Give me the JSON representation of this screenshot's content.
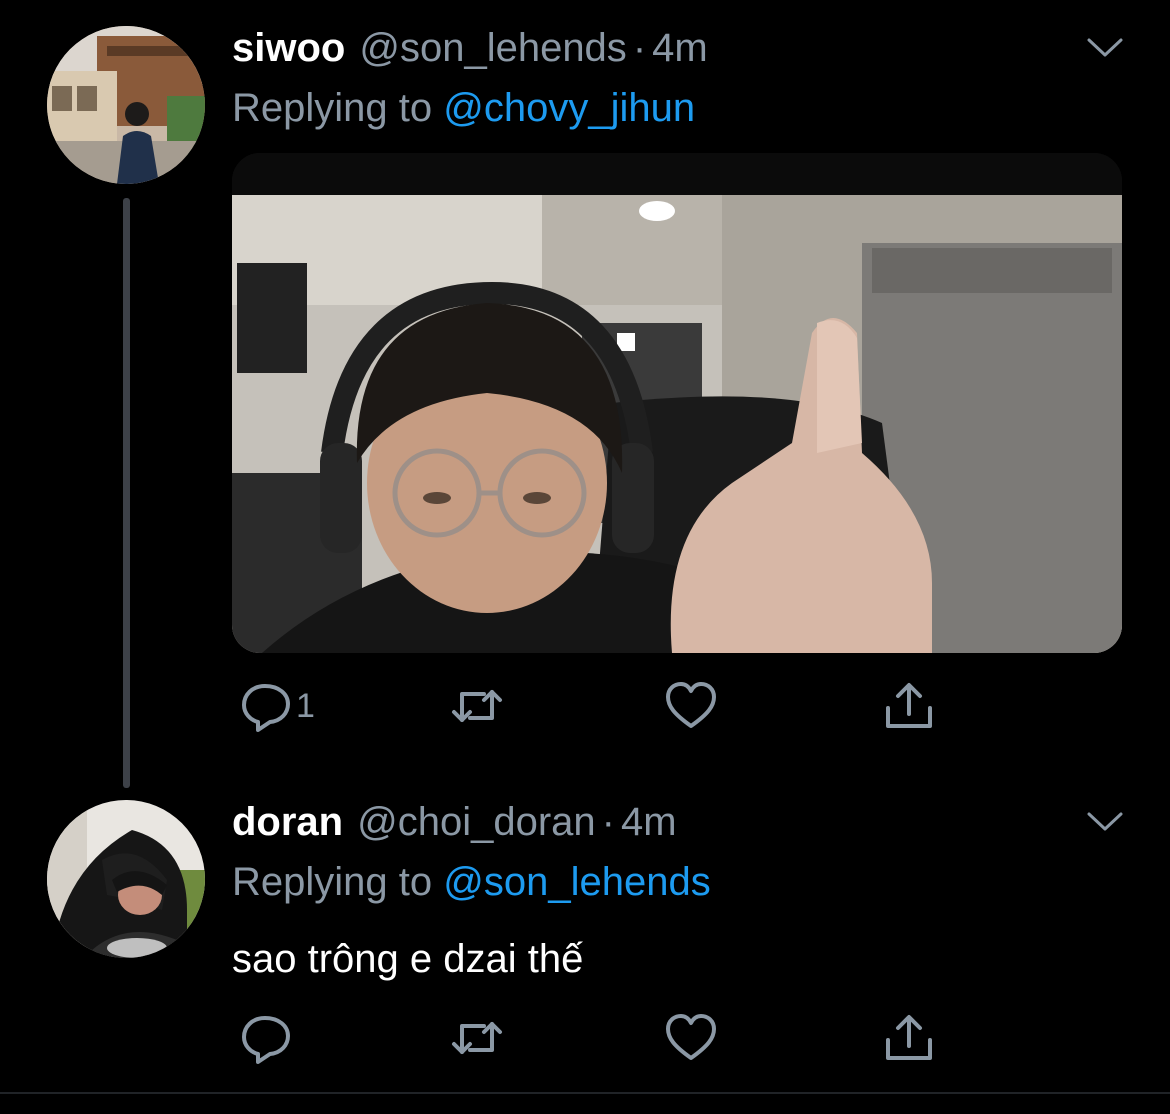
{
  "colors": {
    "background": "#000000",
    "primary_text": "#ffffff",
    "secondary_text": "#8b98a5",
    "accent": "#1d9bf0",
    "thread_line": "#3d4148"
  },
  "tweets": [
    {
      "display_name": "siwoo",
      "handle": "@son_lehends",
      "separator": "·",
      "time": "4m",
      "replying_prefix": "Replying to",
      "replying_to": "@chovy_jihun",
      "has_media": true,
      "actions": {
        "reply_icon": "reply-icon",
        "reply_count": "1",
        "retweet_icon": "retweet-icon",
        "like_icon": "heart-icon",
        "share_icon": "share-icon"
      }
    },
    {
      "display_name": "doran",
      "handle": "@choi_doran",
      "separator": "·",
      "time": "4m",
      "replying_prefix": "Replying to",
      "replying_to": "@son_lehends",
      "text": "sao trông e dzai thế",
      "actions": {
        "reply_icon": "reply-icon",
        "reply_count": "",
        "retweet_icon": "retweet-icon",
        "like_icon": "heart-icon",
        "share_icon": "share-icon"
      }
    }
  ]
}
